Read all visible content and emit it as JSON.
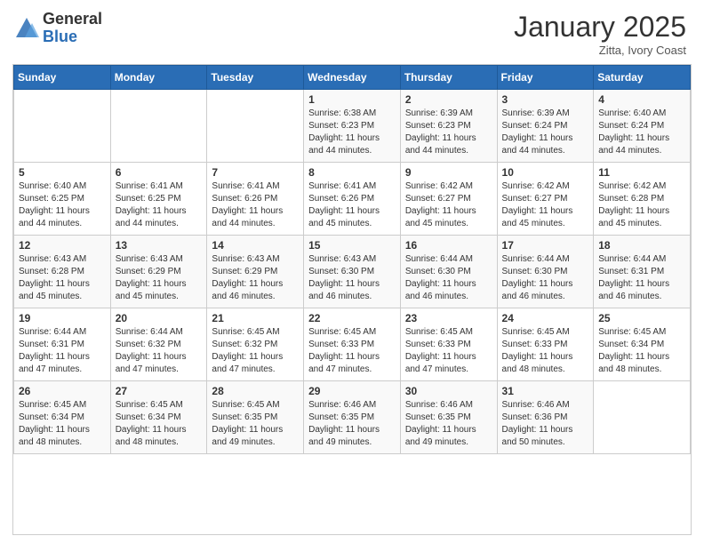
{
  "logo": {
    "general": "General",
    "blue": "Blue"
  },
  "header": {
    "month": "January 2025",
    "location": "Zitta, Ivory Coast"
  },
  "weekdays": [
    "Sunday",
    "Monday",
    "Tuesday",
    "Wednesday",
    "Thursday",
    "Friday",
    "Saturday"
  ],
  "weeks": [
    [
      {
        "day": "",
        "sunrise": "",
        "sunset": "",
        "daylight": ""
      },
      {
        "day": "",
        "sunrise": "",
        "sunset": "",
        "daylight": ""
      },
      {
        "day": "",
        "sunrise": "",
        "sunset": "",
        "daylight": ""
      },
      {
        "day": "1",
        "sunrise": "Sunrise: 6:38 AM",
        "sunset": "Sunset: 6:23 PM",
        "daylight": "Daylight: 11 hours and 44 minutes."
      },
      {
        "day": "2",
        "sunrise": "Sunrise: 6:39 AM",
        "sunset": "Sunset: 6:23 PM",
        "daylight": "Daylight: 11 hours and 44 minutes."
      },
      {
        "day": "3",
        "sunrise": "Sunrise: 6:39 AM",
        "sunset": "Sunset: 6:24 PM",
        "daylight": "Daylight: 11 hours and 44 minutes."
      },
      {
        "day": "4",
        "sunrise": "Sunrise: 6:40 AM",
        "sunset": "Sunset: 6:24 PM",
        "daylight": "Daylight: 11 hours and 44 minutes."
      }
    ],
    [
      {
        "day": "5",
        "sunrise": "Sunrise: 6:40 AM",
        "sunset": "Sunset: 6:25 PM",
        "daylight": "Daylight: 11 hours and 44 minutes."
      },
      {
        "day": "6",
        "sunrise": "Sunrise: 6:41 AM",
        "sunset": "Sunset: 6:25 PM",
        "daylight": "Daylight: 11 hours and 44 minutes."
      },
      {
        "day": "7",
        "sunrise": "Sunrise: 6:41 AM",
        "sunset": "Sunset: 6:26 PM",
        "daylight": "Daylight: 11 hours and 44 minutes."
      },
      {
        "day": "8",
        "sunrise": "Sunrise: 6:41 AM",
        "sunset": "Sunset: 6:26 PM",
        "daylight": "Daylight: 11 hours and 45 minutes."
      },
      {
        "day": "9",
        "sunrise": "Sunrise: 6:42 AM",
        "sunset": "Sunset: 6:27 PM",
        "daylight": "Daylight: 11 hours and 45 minutes."
      },
      {
        "day": "10",
        "sunrise": "Sunrise: 6:42 AM",
        "sunset": "Sunset: 6:27 PM",
        "daylight": "Daylight: 11 hours and 45 minutes."
      },
      {
        "day": "11",
        "sunrise": "Sunrise: 6:42 AM",
        "sunset": "Sunset: 6:28 PM",
        "daylight": "Daylight: 11 hours and 45 minutes."
      }
    ],
    [
      {
        "day": "12",
        "sunrise": "Sunrise: 6:43 AM",
        "sunset": "Sunset: 6:28 PM",
        "daylight": "Daylight: 11 hours and 45 minutes."
      },
      {
        "day": "13",
        "sunrise": "Sunrise: 6:43 AM",
        "sunset": "Sunset: 6:29 PM",
        "daylight": "Daylight: 11 hours and 45 minutes."
      },
      {
        "day": "14",
        "sunrise": "Sunrise: 6:43 AM",
        "sunset": "Sunset: 6:29 PM",
        "daylight": "Daylight: 11 hours and 46 minutes."
      },
      {
        "day": "15",
        "sunrise": "Sunrise: 6:43 AM",
        "sunset": "Sunset: 6:30 PM",
        "daylight": "Daylight: 11 hours and 46 minutes."
      },
      {
        "day": "16",
        "sunrise": "Sunrise: 6:44 AM",
        "sunset": "Sunset: 6:30 PM",
        "daylight": "Daylight: 11 hours and 46 minutes."
      },
      {
        "day": "17",
        "sunrise": "Sunrise: 6:44 AM",
        "sunset": "Sunset: 6:30 PM",
        "daylight": "Daylight: 11 hours and 46 minutes."
      },
      {
        "day": "18",
        "sunrise": "Sunrise: 6:44 AM",
        "sunset": "Sunset: 6:31 PM",
        "daylight": "Daylight: 11 hours and 46 minutes."
      }
    ],
    [
      {
        "day": "19",
        "sunrise": "Sunrise: 6:44 AM",
        "sunset": "Sunset: 6:31 PM",
        "daylight": "Daylight: 11 hours and 47 minutes."
      },
      {
        "day": "20",
        "sunrise": "Sunrise: 6:44 AM",
        "sunset": "Sunset: 6:32 PM",
        "daylight": "Daylight: 11 hours and 47 minutes."
      },
      {
        "day": "21",
        "sunrise": "Sunrise: 6:45 AM",
        "sunset": "Sunset: 6:32 PM",
        "daylight": "Daylight: 11 hours and 47 minutes."
      },
      {
        "day": "22",
        "sunrise": "Sunrise: 6:45 AM",
        "sunset": "Sunset: 6:33 PM",
        "daylight": "Daylight: 11 hours and 47 minutes."
      },
      {
        "day": "23",
        "sunrise": "Sunrise: 6:45 AM",
        "sunset": "Sunset: 6:33 PM",
        "daylight": "Daylight: 11 hours and 47 minutes."
      },
      {
        "day": "24",
        "sunrise": "Sunrise: 6:45 AM",
        "sunset": "Sunset: 6:33 PM",
        "daylight": "Daylight: 11 hours and 48 minutes."
      },
      {
        "day": "25",
        "sunrise": "Sunrise: 6:45 AM",
        "sunset": "Sunset: 6:34 PM",
        "daylight": "Daylight: 11 hours and 48 minutes."
      }
    ],
    [
      {
        "day": "26",
        "sunrise": "Sunrise: 6:45 AM",
        "sunset": "Sunset: 6:34 PM",
        "daylight": "Daylight: 11 hours and 48 minutes."
      },
      {
        "day": "27",
        "sunrise": "Sunrise: 6:45 AM",
        "sunset": "Sunset: 6:34 PM",
        "daylight": "Daylight: 11 hours and 48 minutes."
      },
      {
        "day": "28",
        "sunrise": "Sunrise: 6:45 AM",
        "sunset": "Sunset: 6:35 PM",
        "daylight": "Daylight: 11 hours and 49 minutes."
      },
      {
        "day": "29",
        "sunrise": "Sunrise: 6:46 AM",
        "sunset": "Sunset: 6:35 PM",
        "daylight": "Daylight: 11 hours and 49 minutes."
      },
      {
        "day": "30",
        "sunrise": "Sunrise: 6:46 AM",
        "sunset": "Sunset: 6:35 PM",
        "daylight": "Daylight: 11 hours and 49 minutes."
      },
      {
        "day": "31",
        "sunrise": "Sunrise: 6:46 AM",
        "sunset": "Sunset: 6:36 PM",
        "daylight": "Daylight: 11 hours and 50 minutes."
      },
      {
        "day": "",
        "sunrise": "",
        "sunset": "",
        "daylight": ""
      }
    ]
  ]
}
